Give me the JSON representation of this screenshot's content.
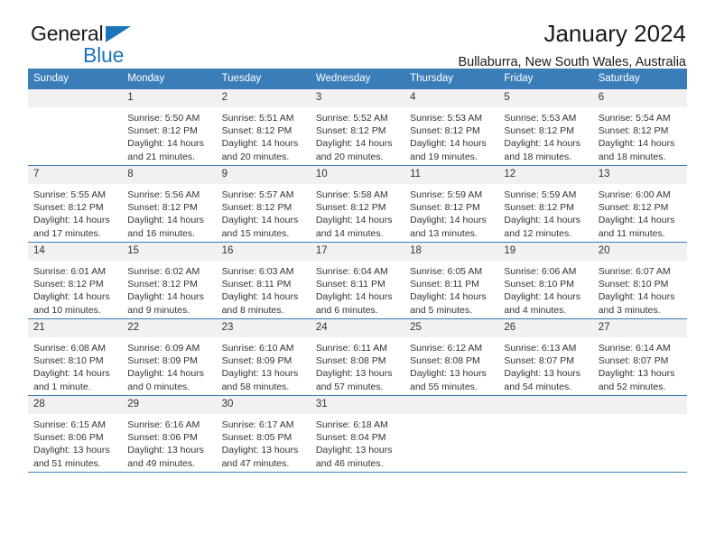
{
  "brand": {
    "name_part1": "General",
    "name_part2": "Blue",
    "accent_color": "#1b75bb",
    "triangle_icon": "logo-triangle-icon"
  },
  "header": {
    "title": "January 2024",
    "subtitle": "Bullaburra, New South Wales, Australia"
  },
  "theme": {
    "header_bar_color": "#3B7DB9",
    "daynum_band_color": "#F1F1F1",
    "text_color": "#333333"
  },
  "weekday_headers": [
    "Sunday",
    "Monday",
    "Tuesday",
    "Wednesday",
    "Thursday",
    "Friday",
    "Saturday"
  ],
  "weeks": [
    [
      {
        "day": "",
        "lines": []
      },
      {
        "day": "1",
        "lines": [
          "Sunrise: 5:50 AM",
          "Sunset: 8:12 PM",
          "Daylight: 14 hours",
          "and 21 minutes."
        ]
      },
      {
        "day": "2",
        "lines": [
          "Sunrise: 5:51 AM",
          "Sunset: 8:12 PM",
          "Daylight: 14 hours",
          "and 20 minutes."
        ]
      },
      {
        "day": "3",
        "lines": [
          "Sunrise: 5:52 AM",
          "Sunset: 8:12 PM",
          "Daylight: 14 hours",
          "and 20 minutes."
        ]
      },
      {
        "day": "4",
        "lines": [
          "Sunrise: 5:53 AM",
          "Sunset: 8:12 PM",
          "Daylight: 14 hours",
          "and 19 minutes."
        ]
      },
      {
        "day": "5",
        "lines": [
          "Sunrise: 5:53 AM",
          "Sunset: 8:12 PM",
          "Daylight: 14 hours",
          "and 18 minutes."
        ]
      },
      {
        "day": "6",
        "lines": [
          "Sunrise: 5:54 AM",
          "Sunset: 8:12 PM",
          "Daylight: 14 hours",
          "and 18 minutes."
        ]
      }
    ],
    [
      {
        "day": "7",
        "lines": [
          "Sunrise: 5:55 AM",
          "Sunset: 8:12 PM",
          "Daylight: 14 hours",
          "and 17 minutes."
        ]
      },
      {
        "day": "8",
        "lines": [
          "Sunrise: 5:56 AM",
          "Sunset: 8:12 PM",
          "Daylight: 14 hours",
          "and 16 minutes."
        ]
      },
      {
        "day": "9",
        "lines": [
          "Sunrise: 5:57 AM",
          "Sunset: 8:12 PM",
          "Daylight: 14 hours",
          "and 15 minutes."
        ]
      },
      {
        "day": "10",
        "lines": [
          "Sunrise: 5:58 AM",
          "Sunset: 8:12 PM",
          "Daylight: 14 hours",
          "and 14 minutes."
        ]
      },
      {
        "day": "11",
        "lines": [
          "Sunrise: 5:59 AM",
          "Sunset: 8:12 PM",
          "Daylight: 14 hours",
          "and 13 minutes."
        ]
      },
      {
        "day": "12",
        "lines": [
          "Sunrise: 5:59 AM",
          "Sunset: 8:12 PM",
          "Daylight: 14 hours",
          "and 12 minutes."
        ]
      },
      {
        "day": "13",
        "lines": [
          "Sunrise: 6:00 AM",
          "Sunset: 8:12 PM",
          "Daylight: 14 hours",
          "and 11 minutes."
        ]
      }
    ],
    [
      {
        "day": "14",
        "lines": [
          "Sunrise: 6:01 AM",
          "Sunset: 8:12 PM",
          "Daylight: 14 hours",
          "and 10 minutes."
        ]
      },
      {
        "day": "15",
        "lines": [
          "Sunrise: 6:02 AM",
          "Sunset: 8:12 PM",
          "Daylight: 14 hours",
          "and 9 minutes."
        ]
      },
      {
        "day": "16",
        "lines": [
          "Sunrise: 6:03 AM",
          "Sunset: 8:11 PM",
          "Daylight: 14 hours",
          "and 8 minutes."
        ]
      },
      {
        "day": "17",
        "lines": [
          "Sunrise: 6:04 AM",
          "Sunset: 8:11 PM",
          "Daylight: 14 hours",
          "and 6 minutes."
        ]
      },
      {
        "day": "18",
        "lines": [
          "Sunrise: 6:05 AM",
          "Sunset: 8:11 PM",
          "Daylight: 14 hours",
          "and 5 minutes."
        ]
      },
      {
        "day": "19",
        "lines": [
          "Sunrise: 6:06 AM",
          "Sunset: 8:10 PM",
          "Daylight: 14 hours",
          "and 4 minutes."
        ]
      },
      {
        "day": "20",
        "lines": [
          "Sunrise: 6:07 AM",
          "Sunset: 8:10 PM",
          "Daylight: 14 hours",
          "and 3 minutes."
        ]
      }
    ],
    [
      {
        "day": "21",
        "lines": [
          "Sunrise: 6:08 AM",
          "Sunset: 8:10 PM",
          "Daylight: 14 hours",
          "and 1 minute."
        ]
      },
      {
        "day": "22",
        "lines": [
          "Sunrise: 6:09 AM",
          "Sunset: 8:09 PM",
          "Daylight: 14 hours",
          "and 0 minutes."
        ]
      },
      {
        "day": "23",
        "lines": [
          "Sunrise: 6:10 AM",
          "Sunset: 8:09 PM",
          "Daylight: 13 hours",
          "and 58 minutes."
        ]
      },
      {
        "day": "24",
        "lines": [
          "Sunrise: 6:11 AM",
          "Sunset: 8:08 PM",
          "Daylight: 13 hours",
          "and 57 minutes."
        ]
      },
      {
        "day": "25",
        "lines": [
          "Sunrise: 6:12 AM",
          "Sunset: 8:08 PM",
          "Daylight: 13 hours",
          "and 55 minutes."
        ]
      },
      {
        "day": "26",
        "lines": [
          "Sunrise: 6:13 AM",
          "Sunset: 8:07 PM",
          "Daylight: 13 hours",
          "and 54 minutes."
        ]
      },
      {
        "day": "27",
        "lines": [
          "Sunrise: 6:14 AM",
          "Sunset: 8:07 PM",
          "Daylight: 13 hours",
          "and 52 minutes."
        ]
      }
    ],
    [
      {
        "day": "28",
        "lines": [
          "Sunrise: 6:15 AM",
          "Sunset: 8:06 PM",
          "Daylight: 13 hours",
          "and 51 minutes."
        ]
      },
      {
        "day": "29",
        "lines": [
          "Sunrise: 6:16 AM",
          "Sunset: 8:06 PM",
          "Daylight: 13 hours",
          "and 49 minutes."
        ]
      },
      {
        "day": "30",
        "lines": [
          "Sunrise: 6:17 AM",
          "Sunset: 8:05 PM",
          "Daylight: 13 hours",
          "and 47 minutes."
        ]
      },
      {
        "day": "31",
        "lines": [
          "Sunrise: 6:18 AM",
          "Sunset: 8:04 PM",
          "Daylight: 13 hours",
          "and 46 minutes."
        ]
      },
      {
        "day": "",
        "lines": []
      },
      {
        "day": "",
        "lines": []
      },
      {
        "day": "",
        "lines": []
      }
    ]
  ]
}
